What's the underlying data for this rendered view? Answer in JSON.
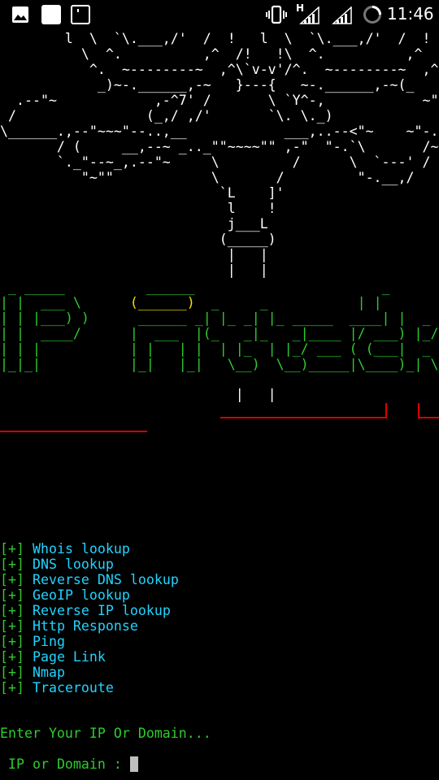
{
  "status_bar": {
    "network_type": "H",
    "time": "11:46"
  },
  "ascii_art": "        l  \\  `\\.___,/'  /  !   l  \\  `\\.___,/'  /  !\n          \\  ^.          ,^  /!   !\\  ^.          ,^  /\n           ^.  ~--------~  ,^\\`v-v'/^.  ~--------~  ,^\n            _)~-.______,-~   }---{   ~-.______,-~(_\n  .--\"~            ,-^7' /       \\ `Y^-,            ~\"--.\n /                (_,/ ,/'       `\\. \\._)                 \\\n\\______.,--\"~~~\"--..,__            ___,..--<\"~    ~\"-.,___/\n       / (     __,--~ _.._\"\"~~~~\"\" ,-\"  \"-.`\\       /~.-\"\n       `._\"--~_,.--\"~     \\         /      \\  `---' /\n          \"~\"\"            \\       /         \"-.__,/\n                           `L    ]'\n                            l    !\n                            j___L\n                           (_____)\n                            |   |\n                            |   |",
  "banner": {
    "line1_a": " _ _____          ______                       _  ",
    "line2_a": "| |  ___ \\      ",
    "line2_yellow": "(______)",
    "line2_b": "  _     _           | | ",
    "line3": "| | |___) )      ______ _| |_ _| |_ _____  ____| |  _",
    "line4": "| |  ____/      |  ___  |(_   _|_   _|____ |/ ___) |_/ )",
    "line5": "| | |           | |   | |  | |_  | |_/ ___ ( (___|  _ (",
    "line6": "|_|_|           |_|   |_|   \\__)  \\__)_____|\\____)_| \\_)"
  },
  "art_bottom": "                             |   |",
  "menu": {
    "marker": "[+]",
    "items": [
      "Whois lookup",
      "DNS lookup",
      "Reverse DNS lookup",
      "GeoIP lookup",
      "Reverse IP lookup",
      "Http Response",
      "Ping",
      "Page Link",
      "Nmap",
      "Traceroute"
    ]
  },
  "prompt": {
    "message": "Enter Your IP Or Domain...",
    "input_label": "IP or Domain : "
  },
  "colors": {
    "background": "#000000",
    "green": "#2ecc2e",
    "cyan": "#20d4ff",
    "yellow": "#f2e200",
    "red": "#d90000",
    "white": "#ffffff"
  },
  "icons": [
    "gallery-icon",
    "notification-square-icon",
    "sd-card-icon",
    "vibrate-icon",
    "signal-icon",
    "battery-saver-icon"
  ]
}
